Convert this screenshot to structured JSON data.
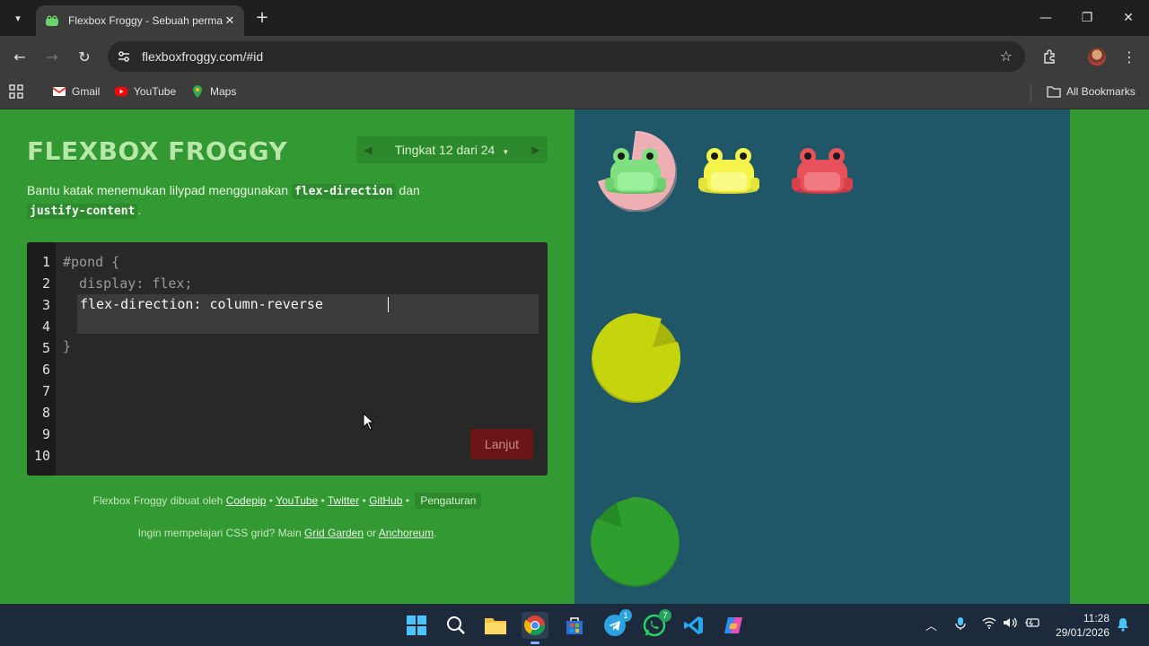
{
  "browser": {
    "tab_title": "Flexbox Froggy - Sebuah permainan",
    "url": "flexboxfroggy.com/#id",
    "bookmarks": [
      {
        "label": "Gmail"
      },
      {
        "label": "YouTube"
      },
      {
        "label": "Maps"
      }
    ],
    "all_bookmarks_label": "All Bookmarks"
  },
  "game": {
    "brand": "FLEXBOX FROGGY",
    "level_label": "Tingkat 12 dari 24",
    "instructions": {
      "prefix": "Bantu katak menemukan lilypad menggunakan ",
      "code1": "flex-direction",
      "middle": " dan",
      "code2": "justify-content",
      "suffix": "."
    },
    "editor": {
      "line_numbers": [
        "1",
        "2",
        "3",
        "4",
        "5",
        "6",
        "7",
        "8",
        "9",
        "10"
      ],
      "line1": "#pond {",
      "line2": "  display: flex;",
      "input_value": "flex-direction: column-reverse",
      "line5": "}"
    },
    "next_button": "Lanjut",
    "credits": {
      "prefix": "Flexbox Froggy dibuat oleh ",
      "links": [
        "Codepip",
        "YouTube",
        "Twitter",
        "GitHub"
      ],
      "separator": " • ",
      "settings": "Pengaturan"
    },
    "promo": {
      "prefix": "Ingin mempelajari CSS grid? Main ",
      "link1": "Grid Garden",
      "middle": " or ",
      "link2": "Anchoreum",
      "suffix": "."
    },
    "frogs": [
      {
        "color": "green",
        "hex": "#7fe07f"
      },
      {
        "color": "yellow",
        "hex": "#f4f44a"
      },
      {
        "color": "red",
        "hex": "#e8505a"
      }
    ],
    "lilypads": [
      {
        "color": "red",
        "hex": "#f0b6bc"
      },
      {
        "color": "yellow",
        "hex": "#c5d40c"
      },
      {
        "color": "green",
        "hex": "#2e9e2e"
      }
    ]
  },
  "taskbar": {
    "telegram_badge": "1",
    "whatsapp_badge": "7",
    "time": "11:28",
    "date": "29/01/2026"
  },
  "colors": {
    "page_bg": "#339933",
    "pond_bg": "#1f5768",
    "editor_bg": "#282828",
    "next_button_bg": "#6b1616"
  }
}
